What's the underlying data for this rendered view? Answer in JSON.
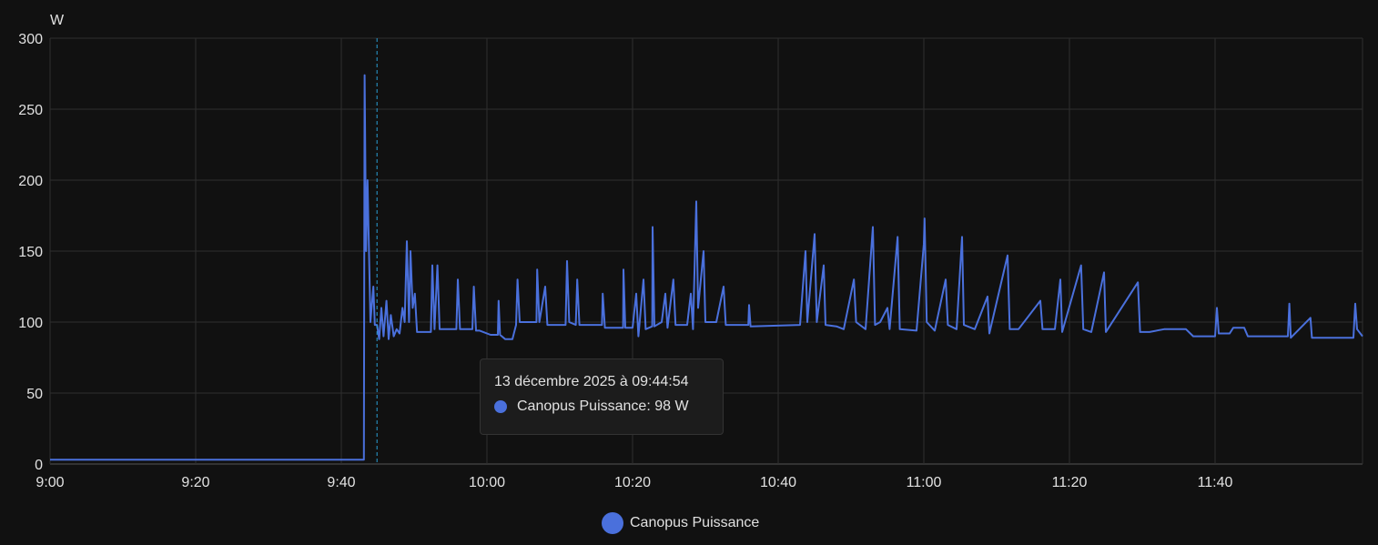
{
  "chart_data": {
    "type": "line",
    "unit_label": "W",
    "ylim": [
      0,
      300
    ],
    "yticks": [
      0,
      50,
      100,
      150,
      200,
      250,
      300
    ],
    "xlim_minutes_from_9_00": [
      0,
      180.25
    ],
    "xticks": [
      {
        "t": 0,
        "label": "9:00"
      },
      {
        "t": 20,
        "label": "9:20"
      },
      {
        "t": 40,
        "label": "9:40"
      },
      {
        "t": 60,
        "label": "10:00"
      },
      {
        "t": 80,
        "label": "10:20"
      },
      {
        "t": 100,
        "label": "10:40"
      },
      {
        "t": 120,
        "label": "11:00"
      },
      {
        "t": 140,
        "label": "11:20"
      },
      {
        "t": 160,
        "label": "11:40"
      }
    ],
    "grid": true,
    "legend_position": "bottom-center",
    "series": [
      {
        "name": "Canopus Puissance",
        "color": "#4a70dc",
        "points": [
          [
            0,
            3
          ],
          [
            43.1,
            3
          ],
          [
            43.2,
            274
          ],
          [
            43.4,
            150
          ],
          [
            43.6,
            200
          ],
          [
            43.8,
            150
          ],
          [
            44.0,
            100
          ],
          [
            44.4,
            125
          ],
          [
            44.6,
            98
          ],
          [
            44.9,
            98
          ],
          [
            45.2,
            88
          ],
          [
            45.5,
            110
          ],
          [
            45.8,
            90
          ],
          [
            46.2,
            115
          ],
          [
            46.5,
            88
          ],
          [
            46.8,
            105
          ],
          [
            47.2,
            90
          ],
          [
            47.6,
            95
          ],
          [
            48,
            92
          ],
          [
            48.4,
            110
          ],
          [
            48.7,
            100
          ],
          [
            49.0,
            157
          ],
          [
            49.3,
            100
          ],
          [
            49.5,
            150
          ],
          [
            49.8,
            110
          ],
          [
            50.1,
            120
          ],
          [
            50.4,
            93
          ],
          [
            51,
            93
          ],
          [
            52.3,
            93
          ],
          [
            52.5,
            140
          ],
          [
            52.8,
            95
          ],
          [
            53.2,
            140
          ],
          [
            53.5,
            95
          ],
          [
            55.8,
            95
          ],
          [
            56,
            130
          ],
          [
            56.3,
            95
          ],
          [
            58,
            95
          ],
          [
            58.2,
            125
          ],
          [
            58.5,
            94
          ],
          [
            59,
            94
          ],
          [
            60.5,
            91
          ],
          [
            61.5,
            91
          ],
          [
            61.6,
            115
          ],
          [
            61.8,
            91
          ],
          [
            62.5,
            88
          ],
          [
            63.5,
            88
          ],
          [
            64,
            98
          ],
          [
            64.2,
            130
          ],
          [
            64.5,
            100
          ],
          [
            66.8,
            100
          ],
          [
            66.9,
            137
          ],
          [
            67.2,
            100
          ],
          [
            68,
            125
          ],
          [
            68.3,
            98
          ],
          [
            70.8,
            98
          ],
          [
            71,
            143
          ],
          [
            71.3,
            100
          ],
          [
            72.2,
            98
          ],
          [
            72.4,
            130
          ],
          [
            72.7,
            98
          ],
          [
            75.8,
            98
          ],
          [
            75.9,
            120
          ],
          [
            76.2,
            96
          ],
          [
            78.7,
            96
          ],
          [
            78.75,
            137
          ],
          [
            79,
            96
          ],
          [
            80,
            96
          ],
          [
            80.5,
            120
          ],
          [
            80.8,
            90
          ],
          [
            81.5,
            130
          ],
          [
            81.8,
            95
          ],
          [
            82.7,
            97
          ],
          [
            82.75,
            167
          ],
          [
            83,
            97
          ],
          [
            84,
            100
          ],
          [
            84.5,
            120
          ],
          [
            84.8,
            96
          ],
          [
            85.6,
            130
          ],
          [
            85.9,
            98
          ],
          [
            87.5,
            98
          ],
          [
            88,
            120
          ],
          [
            88.3,
            95
          ],
          [
            88.75,
            185
          ],
          [
            89,
            110
          ],
          [
            89.75,
            150
          ],
          [
            90,
            100
          ],
          [
            91.5,
            100
          ],
          [
            92.5,
            125
          ],
          [
            92.8,
            98
          ],
          [
            95.9,
            98
          ],
          [
            96,
            112
          ],
          [
            96.2,
            97
          ],
          [
            103,
            98
          ],
          [
            103.75,
            150
          ],
          [
            104,
            100
          ],
          [
            105,
            162
          ],
          [
            105.3,
            100
          ],
          [
            106.25,
            140
          ],
          [
            106.5,
            98
          ],
          [
            108,
            97
          ],
          [
            109,
            95
          ],
          [
            110.4,
            130
          ],
          [
            110.7,
            100
          ],
          [
            112,
            95
          ],
          [
            113,
            167
          ],
          [
            113.3,
            98
          ],
          [
            114,
            100
          ],
          [
            115,
            110
          ],
          [
            115.3,
            95
          ],
          [
            116.4,
            160
          ],
          [
            116.7,
            95
          ],
          [
            119,
            94
          ],
          [
            120,
            155
          ],
          [
            120.1,
            173
          ],
          [
            120.4,
            100
          ],
          [
            121.5,
            94
          ],
          [
            123,
            130
          ],
          [
            123.3,
            98
          ],
          [
            124.5,
            95
          ],
          [
            125.25,
            160
          ],
          [
            125.5,
            98
          ],
          [
            127,
            95
          ],
          [
            128.75,
            118
          ],
          [
            129,
            92
          ],
          [
            131.5,
            147
          ],
          [
            131.8,
            95
          ],
          [
            133,
            95
          ],
          [
            136,
            115
          ],
          [
            136.3,
            95
          ],
          [
            138,
            95
          ],
          [
            138.75,
            130
          ],
          [
            139,
            93
          ],
          [
            141.6,
            140
          ],
          [
            141.9,
            95
          ],
          [
            143,
            93
          ],
          [
            144.75,
            135
          ],
          [
            145,
            93
          ],
          [
            149.4,
            128
          ],
          [
            149.7,
            93
          ],
          [
            151,
            93
          ],
          [
            153,
            95
          ],
          [
            156,
            95
          ],
          [
            157,
            90
          ],
          [
            160,
            90
          ],
          [
            160.25,
            110
          ],
          [
            160.5,
            92
          ],
          [
            162,
            92
          ],
          [
            162.5,
            96
          ],
          [
            164,
            96
          ],
          [
            164.5,
            90
          ],
          [
            170,
            90
          ],
          [
            170.2,
            113
          ],
          [
            170.4,
            89
          ],
          [
            173.1,
            103
          ],
          [
            173.3,
            89
          ],
          [
            179,
            89
          ],
          [
            179.25,
            113
          ],
          [
            179.5,
            95
          ],
          [
            180.25,
            90
          ]
        ]
      }
    ],
    "cursor_minutes": 44.9,
    "tooltip": {
      "title": "13 décembre 2025 à 09:44:54",
      "series_label": "Canopus Puissance: 98 W"
    },
    "accent_color": "#2a9fd6"
  }
}
